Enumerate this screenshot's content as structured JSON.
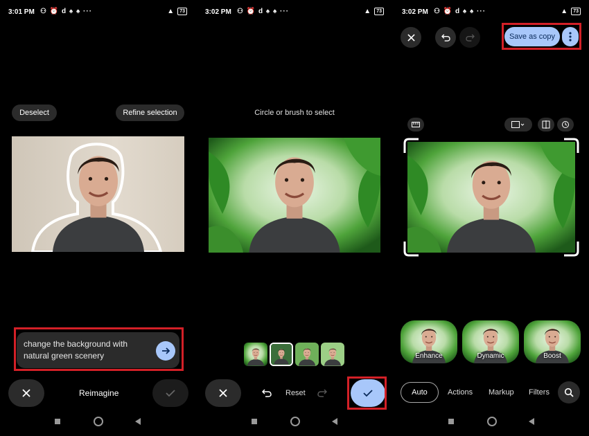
{
  "status": [
    {
      "time": "3:01 PM",
      "icons": "⚇ ⏰ d ♠ ♠ ···",
      "battery": "73"
    },
    {
      "time": "3:02 PM",
      "icons": "⚇ ⏰ d ♠ ♠ ···",
      "battery": "73"
    },
    {
      "time": "3:02 PM",
      "icons": "⚇ ⏰ d ♠ ♠ ···",
      "battery": "73"
    }
  ],
  "panel1": {
    "deselect": "Deselect",
    "refine": "Refine selection",
    "prompt": "change the background with natural green scenery",
    "title": "Reimagine"
  },
  "panel2": {
    "hint": "Circle or brush to select",
    "reset": "Reset",
    "thumb_count": 4
  },
  "panel3": {
    "save_copy": "Save as copy",
    "filters": [
      "Enhance",
      "Dynamic",
      "Boost"
    ],
    "tabs": [
      "Auto",
      "Actions",
      "Markup",
      "Filters"
    ],
    "active_tab": "Auto"
  },
  "colors": {
    "accent": "#a8c7fa",
    "highlight": "#d32027",
    "button_dark": "#2b2b2b"
  }
}
